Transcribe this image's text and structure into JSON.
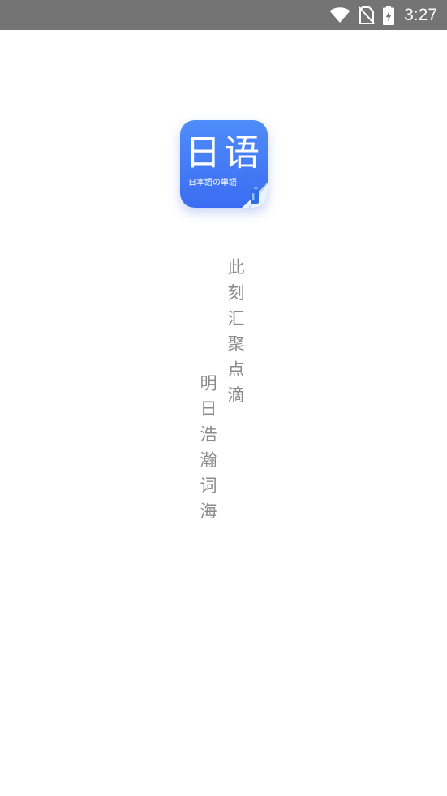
{
  "status_bar": {
    "time": "3:27",
    "icons": [
      "wifi-icon",
      "no-sim-icon",
      "battery-charging-icon"
    ]
  },
  "app_icon": {
    "title": "日语",
    "subtitle": "日本語の単語",
    "colors": {
      "background_top": "#4f8df9",
      "background_bottom": "#3b6cf2"
    }
  },
  "slogan": {
    "line1": "此刻汇聚点滴",
    "line2": "明日浩瀚词海",
    "color": "#8a8a8a"
  }
}
